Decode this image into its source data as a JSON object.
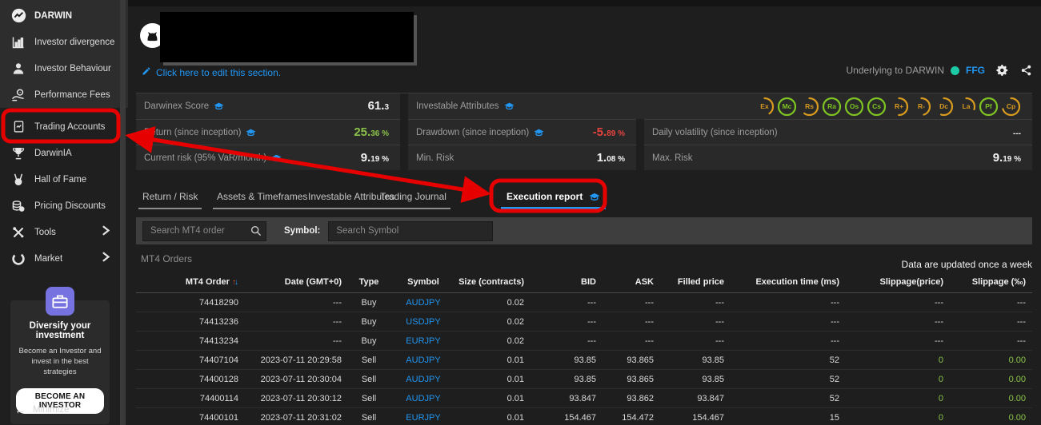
{
  "app": {
    "accent_blue": "#2196f3",
    "green": "#8bc34a",
    "red": "#e8433e",
    "annotation_red": "#e60000",
    "teal_dot": "#1ec9a6"
  },
  "sidebar": {
    "items": [
      {
        "label": "DARWIN"
      },
      {
        "label": "Investor divergence"
      },
      {
        "label": "Investor Behaviour"
      },
      {
        "label": "Performance Fees"
      },
      {
        "label": "Trading Accounts"
      },
      {
        "label": "DarwinIA"
      },
      {
        "label": "Hall of Fame"
      },
      {
        "label": "Pricing Discounts"
      },
      {
        "label": "Tools"
      },
      {
        "label": "Market"
      }
    ],
    "promo": {
      "title": "Diversify your investment",
      "body": "Become an Investor and invest in the best strategies",
      "button": "BECOME AN INVESTOR"
    },
    "minimize": "Minimize"
  },
  "header": {
    "edit_link": "Click here to edit this section.",
    "underlying_label": "Underlying to DARWIN",
    "underlying_value": "FFG"
  },
  "stats": {
    "score_label": "Darwinex Score",
    "score_main": "61.",
    "score_small": "3",
    "attributes_label": "Investable Attributes",
    "return_label": "Return (since inception)",
    "return_main": "25.",
    "return_small": "36 %",
    "drawdown_label": "Drawdown (since inception)",
    "drawdown_main": "-5.",
    "drawdown_small": "89 %",
    "volatility_label": "Daily volatility (since inception)",
    "volatility_value": "---",
    "current_risk_label": "Current risk (95% VaR/month)",
    "current_risk_main": "9.",
    "current_risk_small": "19 %",
    "min_risk_label": "Min. Risk",
    "min_risk_main": "1.",
    "min_risk_small": "08 %",
    "max_risk_label": "Max. Risk",
    "max_risk_main": "9.",
    "max_risk_small": "19 %"
  },
  "badges": [
    {
      "label": "Ex",
      "pct": 40,
      "color": "#d89b1f"
    },
    {
      "label": "Mc",
      "pct": 100,
      "color": "#7ec422"
    },
    {
      "label": "Rs",
      "pct": 60,
      "color": "#d89b1f"
    },
    {
      "label": "Ra",
      "pct": 100,
      "color": "#7ec422"
    },
    {
      "label": "Os",
      "pct": 100,
      "color": "#7ec422"
    },
    {
      "label": "Cs",
      "pct": 100,
      "color": "#7ec422"
    },
    {
      "label": "R+",
      "pct": 50,
      "color": "#d89b1f"
    },
    {
      "label": "R-",
      "pct": 45,
      "color": "#d89b1f"
    },
    {
      "label": "Dc",
      "pct": 55,
      "color": "#d89b1f"
    },
    {
      "label": "La",
      "pct": 30,
      "color": "#d89b1f"
    },
    {
      "label": "Pf",
      "pct": 100,
      "color": "#7ec422"
    },
    {
      "label": "Cp",
      "pct": 70,
      "color": "#d89b1f"
    }
  ],
  "tabs": [
    {
      "label": "Return / Risk"
    },
    {
      "label": "Assets & Timeframes"
    },
    {
      "label": "Investable Attributes"
    },
    {
      "label": "Trading Journal"
    },
    {
      "label": "Execution report",
      "active": true
    }
  ],
  "filters": {
    "order_placeholder": "Search MT4 order",
    "symbol_label": "Symbol:",
    "symbol_placeholder": "Search Symbol"
  },
  "table": {
    "title": "MT4 Orders",
    "note": "Data are updated once a week",
    "columns": [
      "MT4 Order",
      "Date (GMT+0)",
      "Type",
      "Symbol",
      "Size (contracts)",
      "BID",
      "ASK",
      "Filled price",
      "Execution time (ms)",
      "Slippage(price)",
      "Slippage (‰)"
    ],
    "rows": [
      [
        "74418290",
        "---",
        "Buy",
        "AUDJPY",
        "0.02",
        "---",
        "---",
        "---",
        "---",
        "---",
        "---"
      ],
      [
        "74413236",
        "---",
        "Buy",
        "USDJPY",
        "0.02",
        "---",
        "---",
        "---",
        "---",
        "---",
        "---"
      ],
      [
        "74413234",
        "---",
        "Buy",
        "EURJPY",
        "0.02",
        "---",
        "---",
        "---",
        "---",
        "---",
        "---"
      ],
      [
        "74407104",
        "2023-07-11 20:29:58",
        "Sell",
        "AUDJPY",
        "0.01",
        "93.85",
        "93.865",
        "93.85",
        "52",
        "0",
        "0.00"
      ],
      [
        "74400128",
        "2023-07-11 20:30:04",
        "Sell",
        "AUDJPY",
        "0.01",
        "93.85",
        "93.865",
        "93.85",
        "52",
        "0",
        "0.00"
      ],
      [
        "74400114",
        "2023-07-11 20:30:12",
        "Sell",
        "AUDJPY",
        "0.01",
        "93.847",
        "93.862",
        "93.847",
        "52",
        "0",
        "0.00"
      ],
      [
        "74400101",
        "2023-07-11 20:31:02",
        "Sell",
        "EURJPY",
        "0.01",
        "154.467",
        "154.472",
        "154.467",
        "15",
        "0",
        "0.00"
      ]
    ]
  }
}
